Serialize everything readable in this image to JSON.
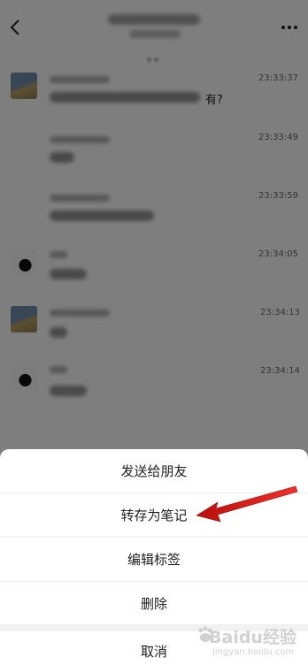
{
  "messages": [
    {
      "time": "23:33:37",
      "trailing_text": "有?"
    },
    {
      "time": "23:33:49"
    },
    {
      "time": "23:33:59"
    },
    {
      "time": "23:34:05"
    },
    {
      "time": "23:34:13"
    },
    {
      "time": "23:34:14"
    }
  ],
  "action_sheet": {
    "send_to_friend": "发送给朋友",
    "save_as_note": "转存为笔记",
    "edit_tags": "编辑标签",
    "delete": "删除",
    "cancel": "取消"
  },
  "annotation": {
    "arrow_color": "#e8221e"
  },
  "watermark": {
    "main": "Baidu经验",
    "sub": "jingyan.baidu.com"
  },
  "icons": {
    "back": "chevron-left-icon",
    "more": "more-dots-icon"
  }
}
